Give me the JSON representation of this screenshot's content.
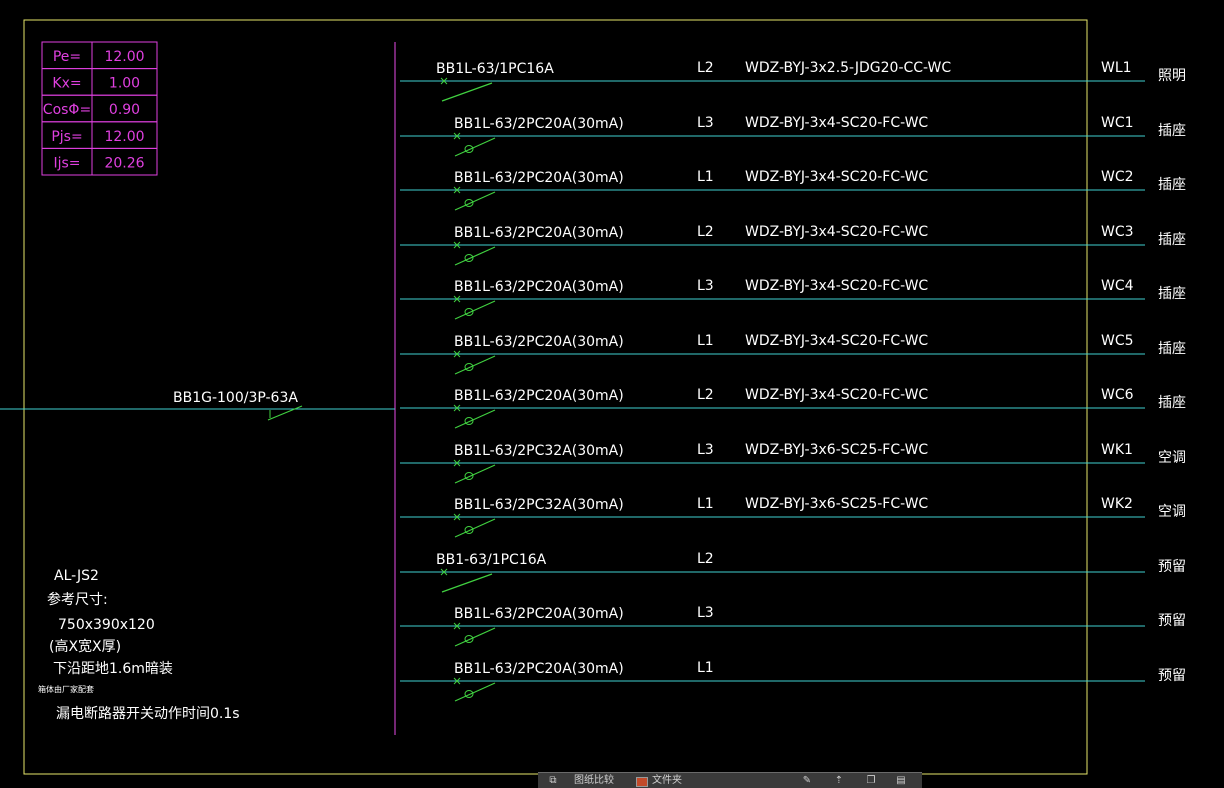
{
  "load_table": [
    {
      "label": "Pe=",
      "value": "12.00"
    },
    {
      "label": "Kx=",
      "value": "1.00"
    },
    {
      "label": "CosΦ=",
      "value": "0.90"
    },
    {
      "label": "Pjs=",
      "value": "12.00"
    },
    {
      "label": "Ijs=",
      "value": "20.26"
    }
  ],
  "main_breaker": "BB1G-100/3P-63A",
  "panel_notes": {
    "panel_id": "AL-JS2",
    "ref_size_label": "参考尺寸:",
    "dimensions": "750x390x120",
    "dim_desc": "(高X宽X厚)",
    "mounting": "下沿距地1.6m暗装",
    "small_note": "箱体由厂家配套",
    "rcd_note": "漏电断路器开关动作时间0.1s"
  },
  "circuits": [
    {
      "breaker": "BB1L-63/1PC16A",
      "phase": "L2",
      "cable": "WDZ-BYJ-3x2.5-JDG20-CC-WC",
      "id": "WL1",
      "load": "照明",
      "rcd": false
    },
    {
      "breaker": "BB1L-63/2PC20A(30mA)",
      "phase": "L3",
      "cable": "WDZ-BYJ-3x4-SC20-FC-WC",
      "id": "WC1",
      "load": "插座",
      "rcd": true
    },
    {
      "breaker": "BB1L-63/2PC20A(30mA)",
      "phase": "L1",
      "cable": "WDZ-BYJ-3x4-SC20-FC-WC",
      "id": "WC2",
      "load": "插座",
      "rcd": true
    },
    {
      "breaker": "BB1L-63/2PC20A(30mA)",
      "phase": "L2",
      "cable": "WDZ-BYJ-3x4-SC20-FC-WC",
      "id": "WC3",
      "load": "插座",
      "rcd": true
    },
    {
      "breaker": "BB1L-63/2PC20A(30mA)",
      "phase": "L3",
      "cable": "WDZ-BYJ-3x4-SC20-FC-WC",
      "id": "WC4",
      "load": "插座",
      "rcd": true
    },
    {
      "breaker": "BB1L-63/2PC20A(30mA)",
      "phase": "L1",
      "cable": "WDZ-BYJ-3x4-SC20-FC-WC",
      "id": "WC5",
      "load": "插座",
      "rcd": true
    },
    {
      "breaker": "BB1L-63/2PC20A(30mA)",
      "phase": "L2",
      "cable": "WDZ-BYJ-3x4-SC20-FC-WC",
      "id": "WC6",
      "load": "插座",
      "rcd": true
    },
    {
      "breaker": "BB1L-63/2PC32A(30mA)",
      "phase": "L3",
      "cable": "WDZ-BYJ-3x6-SC25-FC-WC",
      "id": "WK1",
      "load": "空调",
      "rcd": true
    },
    {
      "breaker": "BB1L-63/2PC32A(30mA)",
      "phase": "L1",
      "cable": "WDZ-BYJ-3x6-SC25-FC-WC",
      "id": "WK2",
      "load": "空调",
      "rcd": true
    },
    {
      "breaker": "BB1-63/1PC16A",
      "phase": "L2",
      "cable": "",
      "id": "",
      "load": "预留",
      "rcd": false
    },
    {
      "breaker": "BB1L-63/2PC20A(30mA)",
      "phase": "L3",
      "cable": "",
      "id": "",
      "load": "预留",
      "rcd": true
    },
    {
      "breaker": "BB1L-63/2PC20A(30mA)",
      "phase": "L1",
      "cable": "",
      "id": "",
      "load": "预留",
      "rcd": true
    }
  ],
  "toolbar": {
    "label1": "图纸比较",
    "label2": "文件夹"
  },
  "colors": {
    "frame": "#e6e66a",
    "busbar": "#c040c0",
    "feeder": "#40d0d0",
    "breaker": "#40d040",
    "table": "#e040e0"
  }
}
